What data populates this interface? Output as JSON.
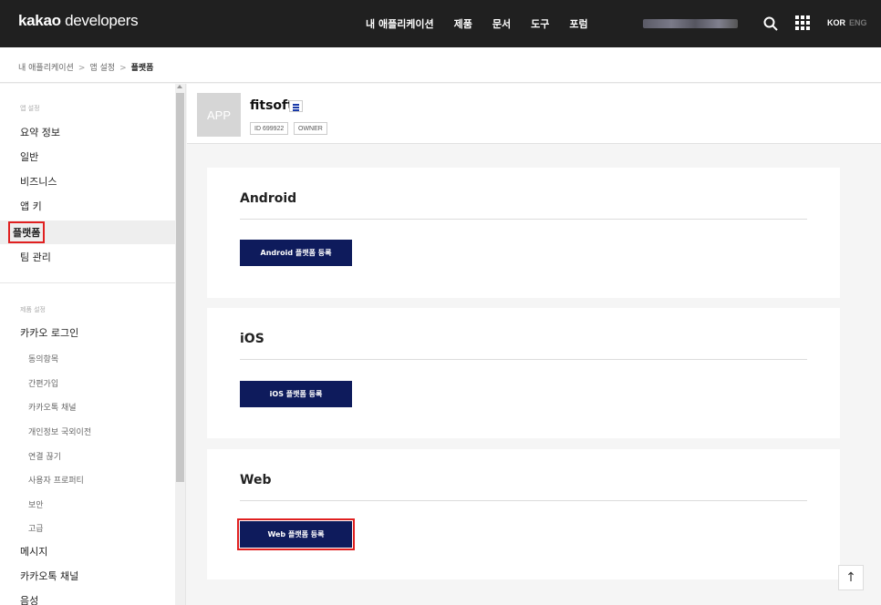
{
  "header": {
    "brand_bold": "kakao",
    "brand_rest": " developers",
    "nav": [
      "내 애플리케이션",
      "제품",
      "문서",
      "도구",
      "포럼"
    ],
    "lang_kor": "KOR",
    "lang_eng": "ENG"
  },
  "breadcrumb": {
    "items": [
      "내 애플리케이션",
      "앱 설정"
    ],
    "current": "플랫폼",
    "separator": ">"
  },
  "sidebar": {
    "section_app": "앱 설정",
    "app_items": [
      "요약 정보",
      "일반",
      "비즈니스",
      "앱 키",
      "플랫폼",
      "팀 관리"
    ],
    "active_item": "플랫폼",
    "section_product": "제품 설정",
    "product_title": "카카오 로그인",
    "sub_items": [
      "동의항목",
      "간편가입",
      "카카오톡 채널",
      "개인정보 국외이전",
      "연결 끊기",
      "사용자 프로퍼티",
      "보안",
      "고급"
    ],
    "more_items": [
      "메시지",
      "카카오톡 채널",
      "음성"
    ]
  },
  "app": {
    "thumb_text": "APP",
    "name": "fitsoft",
    "id_tag": "ID 699922",
    "role_tag": "OWNER"
  },
  "platforms": [
    {
      "title": "Android",
      "button": "Android 플랫폼 등록"
    },
    {
      "title": "iOS",
      "button": "iOS 플랫폼 등록"
    },
    {
      "title": "Web",
      "button": "Web 플랫폼 등록"
    }
  ],
  "scroll_top_label": "↑",
  "colors": {
    "topbar": "#202020",
    "button": "#0e1b5c",
    "highlight": "#e02020"
  }
}
